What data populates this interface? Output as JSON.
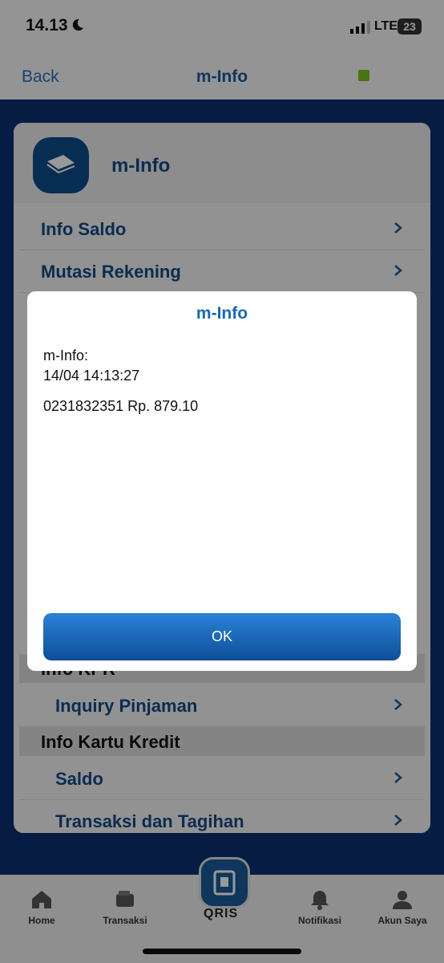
{
  "status": {
    "time": "14.13",
    "network": "LTE",
    "battery": "23"
  },
  "nav": {
    "back_label": "Back",
    "title": "m-Info"
  },
  "card": {
    "title": "m-Info",
    "rows": [
      {
        "label": "Info Saldo"
      },
      {
        "label": "Mutasi Rekening"
      }
    ],
    "partial_section": "Info KPR",
    "kpr_row": "Inquiry Pinjaman",
    "kk_section": "Info Kartu Kredit",
    "kk_rows": [
      {
        "label": "Saldo"
      },
      {
        "label": "Transaksi dan Tagihan"
      }
    ]
  },
  "modal": {
    "title": "m-Info",
    "line1": "m-Info:",
    "line2": "14/04 14:13:27",
    "line3": "0231832351  Rp.  879.10",
    "ok_label": "OK"
  },
  "tabs": [
    {
      "label": "Home",
      "icon": "home-icon"
    },
    {
      "label": "Transaksi",
      "icon": "wallet-icon"
    },
    {
      "label": "QRIS",
      "icon": "qris-icon"
    },
    {
      "label": "Notifikasi",
      "icon": "bell-icon"
    },
    {
      "label": "Akun Saya",
      "icon": "user-icon"
    }
  ]
}
